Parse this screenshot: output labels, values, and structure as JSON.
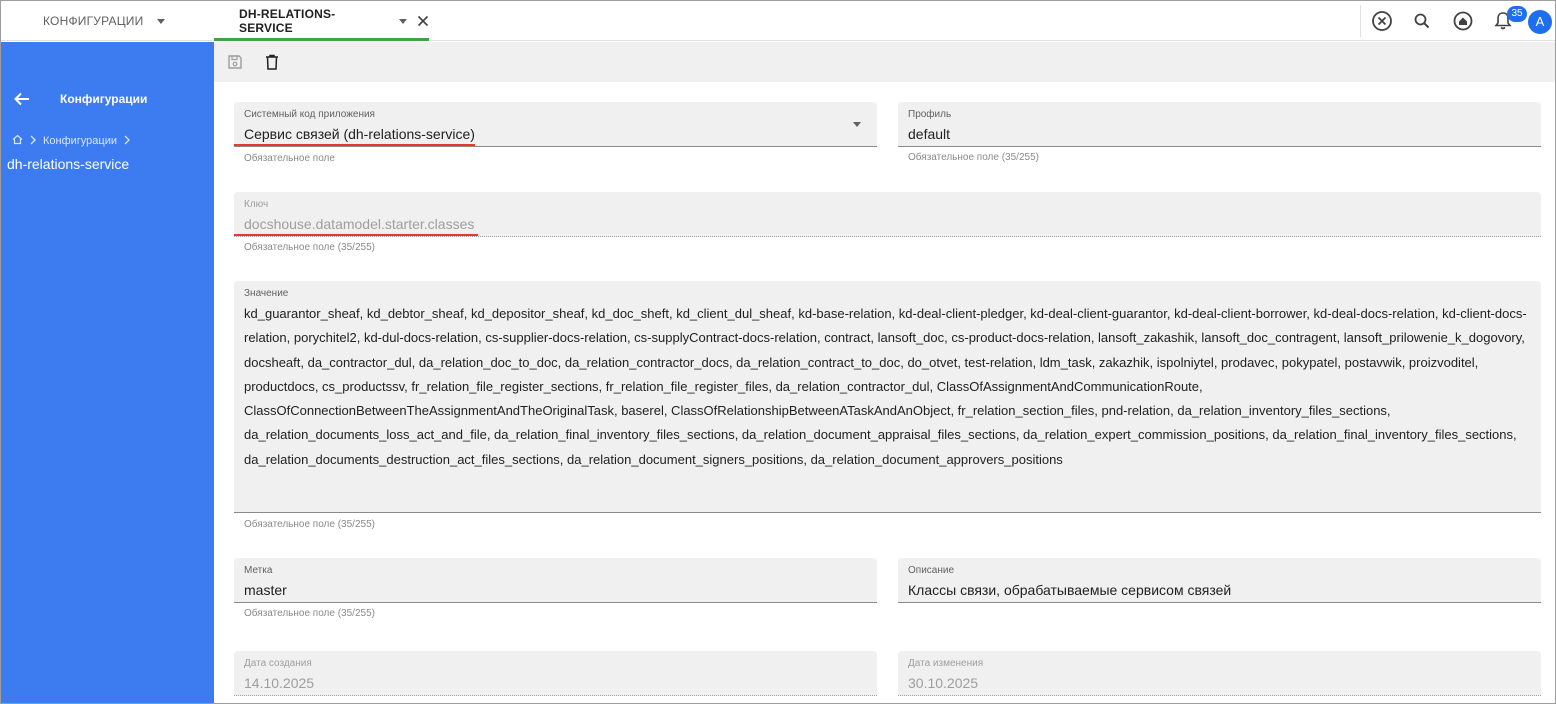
{
  "tabs": {
    "config_label": "КОНФИГУРАЦИИ",
    "active_label": "DH-RELATIONS-SERVICE"
  },
  "topbar": {
    "notification_count": "35",
    "avatar_letter": "A"
  },
  "sidebar": {
    "title": "Конфигурации",
    "breadcrumb_item": "Конфигурации",
    "breadcrumb_current": "dh-relations-service"
  },
  "form": {
    "system_code": {
      "label": "Системный код приложения",
      "value": "Сервис связей (dh-relations-service)",
      "hint": "Обязательное поле"
    },
    "profile": {
      "label": "Профиль",
      "value": "default",
      "hint": "Обязательное поле (35/255)"
    },
    "key": {
      "label": "Ключ",
      "value": "docshouse.datamodel.starter.classes",
      "hint": "Обязательное поле (35/255)"
    },
    "value_field": {
      "label": "Значение",
      "value": "kd_guarantor_sheaf, kd_debtor_sheaf, kd_depositor_sheaf, kd_doc_sheft, kd_client_dul_sheaf, kd-base-relation, kd-deal-client-pledger, kd-deal-client-guarantor, kd-deal-client-borrower, kd-deal-docs-relation, kd-client-docs-relation, porychitel2, kd-dul-docs-relation, cs-supplier-docs-relation, cs-supplyContract-docs-relation, contract, lansoft_doc, cs-product-docs-relation, lansoft_zakashik, lansoft_doc_contragent, lansoft_prilowenie_k_dogovory, docsheaft, da_contractor_dul, da_relation_doc_to_doc, da_relation_contractor_docs, da_relation_contract_to_doc, do_otvet, test-relation, ldm_task, zakazhik, ispolniytel, prodavec, pokypatel, postavwik, proizvoditel, productdocs, cs_productssv, fr_relation_file_register_sections, fr_relation_file_register_files, da_relation_contractor_dul, ClassOfAssignmentAndCommunicationRoute, ClassOfConnectionBetweenTheAssignmentAndTheOriginalTask, baserel, ClassOfRelationshipBetweenATaskAndAnObject, fr_relation_section_files, pnd-relation, da_relation_inventory_files_sections, da_relation_documents_loss_act_and_file, da_relation_final_inventory_files_sections, da_relation_document_appraisal_files_sections, da_relation_expert_commission_positions, da_relation_final_inventory_files_sections, da_relation_documents_destruction_act_files_sections, da_relation_document_signers_positions, da_relation_document_approvers_positions",
      "hint": "Обязательное поле (35/255)"
    },
    "tag": {
      "label": "Метка",
      "value": "master",
      "hint": "Обязательное поле (35/255)"
    },
    "description": {
      "label": "Описание",
      "value": "Классы связи, обрабатываемые сервисом  связей"
    },
    "created": {
      "label": "Дата создания",
      "value": "14.10.2025"
    },
    "modified": {
      "label": "Дата изменения",
      "value": "30.10.2025"
    }
  },
  "colors": {
    "sidebar": "#3d7bf0",
    "accent": "#1e6ff0",
    "active_tab_indicator": "#43a047",
    "annotation": "#e53935"
  }
}
